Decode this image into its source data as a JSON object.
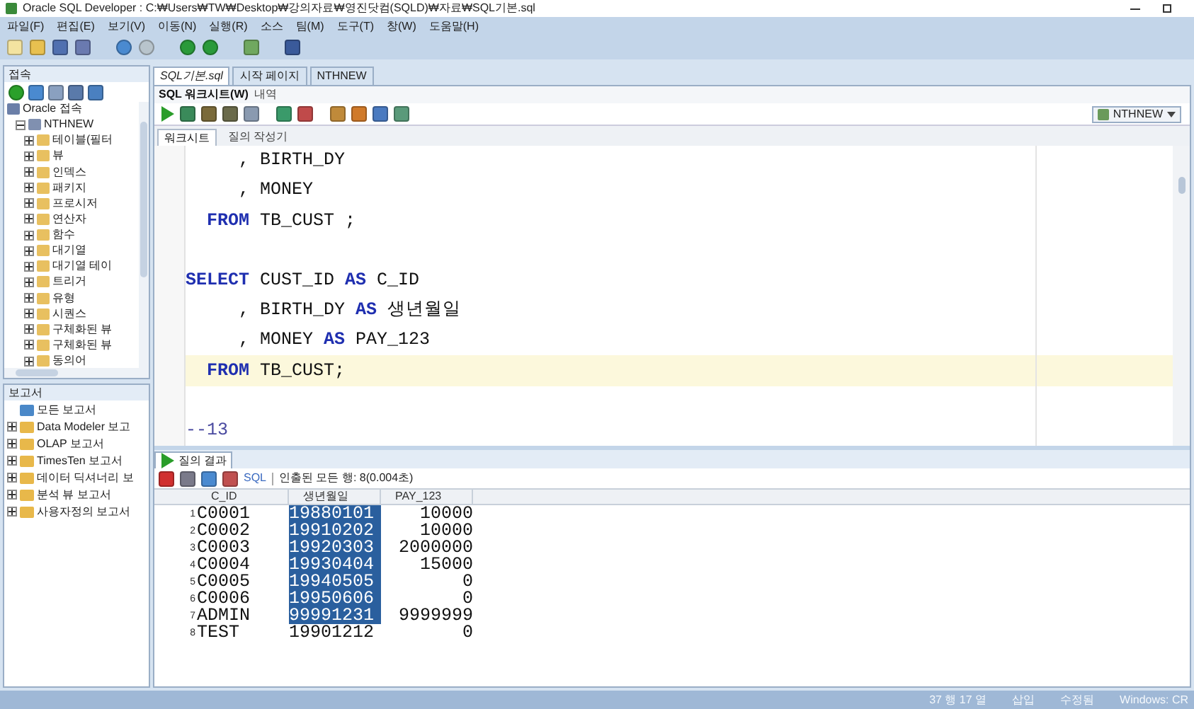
{
  "window": {
    "title": "Oracle SQL Developer : C:₩Users₩TW₩Desktop₩강의자료₩영진닷컴(SQLD)₩자료₩SQL기본.sql"
  },
  "menu": [
    "파일(F)",
    "편집(E)",
    "보기(V)",
    "이동(N)",
    "실행(R)",
    "소스",
    "팀(M)",
    "도구(T)",
    "창(W)",
    "도움말(H)"
  ],
  "connections_panel": {
    "title": "접속",
    "tree": [
      {
        "label": "Oracle 접속",
        "kind": "root",
        "children": [
          {
            "label": "NTHNEW",
            "kind": "connection",
            "expanded": true,
            "children": [
              {
                "label": "테이블(필터",
                "expanded": false
              },
              {
                "label": "뷰",
                "expanded": false
              },
              {
                "label": "인덱스",
                "expanded": false
              },
              {
                "label": "패키지",
                "expanded": false
              },
              {
                "label": "프로시저",
                "expanded": false
              },
              {
                "label": "연산자",
                "expanded": false
              },
              {
                "label": "함수",
                "expanded": false
              },
              {
                "label": "대기열",
                "expanded": false
              },
              {
                "label": "대기열 테이",
                "expanded": false
              },
              {
                "label": "트리거",
                "expanded": false
              },
              {
                "label": "유형",
                "expanded": false
              },
              {
                "label": "시퀀스",
                "expanded": false
              },
              {
                "label": "구체화된 뷰",
                "expanded": false
              },
              {
                "label": "구체화된 뷰",
                "expanded": false
              },
              {
                "label": "동의어",
                "expanded": false
              }
            ]
          }
        ]
      }
    ]
  },
  "reports_panel": {
    "title": "보고서",
    "items": [
      {
        "label": "모든 보고서",
        "kind": "root"
      },
      {
        "label": "Data Modeler 보고",
        "kind": "folder",
        "expanded": false
      },
      {
        "label": "OLAP 보고서",
        "kind": "folder",
        "expanded": false
      },
      {
        "label": "TimesTen 보고서",
        "kind": "folder",
        "expanded": false
      },
      {
        "label": "데이터 딕셔너리 보",
        "kind": "folder",
        "expanded": false
      },
      {
        "label": "분석 뷰 보고서",
        "kind": "folder",
        "expanded": false
      },
      {
        "label": "사용자정의 보고서",
        "kind": "folder",
        "expanded": false
      }
    ]
  },
  "editor_tabs": [
    {
      "label": "SQL기본.sql",
      "selected": true
    },
    {
      "label": "시작 페이지",
      "selected": false
    },
    {
      "label": "NTHNEW",
      "selected": false
    }
  ],
  "sub_tabs": [
    {
      "label": "SQL 워크시트(W)",
      "selected": true
    },
    {
      "label": "내역",
      "selected": false
    }
  ],
  "connection_selector": "NTHNEW",
  "worksheet_tabs": [
    {
      "label": "워크시트",
      "selected": true
    },
    {
      "label": "질의 작성기",
      "selected": false
    }
  ],
  "code_lines": [
    {
      "current": false,
      "tokens": [
        {
          "text": "     , BIRTH_DY",
          "kind": "plain"
        }
      ]
    },
    {
      "current": false,
      "tokens": [
        {
          "text": "     , MONEY",
          "kind": "plain"
        }
      ]
    },
    {
      "current": false,
      "tokens": [
        {
          "text": "  FROM",
          "kind": "keyword"
        },
        {
          "text": " TB_CUST ;",
          "kind": "plain"
        }
      ]
    },
    {
      "current": false
    },
    {
      "current": false,
      "tokens": [
        {
          "text": "SELECT",
          "kind": "keyword"
        },
        {
          "text": " CUST_ID ",
          "kind": "plain"
        },
        {
          "text": "AS",
          "kind": "keyword"
        },
        {
          "text": " C_ID",
          "kind": "plain"
        }
      ]
    },
    {
      "current": false,
      "tokens": [
        {
          "text": "     , BIRTH_DY ",
          "kind": "plain"
        },
        {
          "text": "AS",
          "kind": "keyword"
        },
        {
          "text": " 생년월일",
          "kind": "plain"
        }
      ]
    },
    {
      "current": false,
      "tokens": [
        {
          "text": "     , MONEY ",
          "kind": "plain"
        },
        {
          "text": "AS",
          "kind": "keyword"
        },
        {
          "text": " PAY_123",
          "kind": "plain"
        }
      ]
    },
    {
      "current": true,
      "tokens": [
        {
          "text": "  FROM",
          "kind": "keyword"
        },
        {
          "text": " TB_CUST;",
          "kind": "plain"
        }
      ]
    },
    {
      "current": false
    },
    {
      "current": false,
      "tokens": [
        {
          "text": "--13",
          "kind": "comment"
        }
      ]
    }
  ],
  "results": {
    "tab": "질의 결과",
    "sql_label": "SQL",
    "message": "인출된 모든 행: 8(0.004초)",
    "columns": [
      "C_ID",
      "생년월일",
      "PAY_123"
    ],
    "rows": [
      {
        "num": "1",
        "cells": [
          "C0001",
          "19880101",
          "10000"
        ],
        "selected": [
          false,
          true,
          false
        ]
      },
      {
        "num": "2",
        "cells": [
          "C0002",
          "19910202",
          "10000"
        ],
        "selected": [
          false,
          true,
          false
        ]
      },
      {
        "num": "3",
        "cells": [
          "C0003",
          "19920303",
          "2000000"
        ],
        "selected": [
          false,
          true,
          false
        ]
      },
      {
        "num": "4",
        "cells": [
          "C0004",
          "19930404",
          "15000"
        ],
        "selected": [
          false,
          true,
          false
        ]
      },
      {
        "num": "5",
        "cells": [
          "C0005",
          "19940505",
          "0"
        ],
        "selected": [
          false,
          true,
          false
        ]
      },
      {
        "num": "6",
        "cells": [
          "C0006",
          "19950606",
          "0"
        ],
        "selected": [
          false,
          true,
          false
        ]
      },
      {
        "num": "7",
        "cells": [
          "ADMIN",
          "99991231",
          "9999999"
        ],
        "selected": [
          false,
          true,
          false
        ]
      },
      {
        "num": "8",
        "cells": [
          "TEST",
          "19901212",
          "0"
        ],
        "selected": [
          false,
          false,
          false
        ]
      }
    ]
  },
  "status_bar": [
    "37 행 17 열",
    "삽입",
    "수정됨",
    "Windows: CR"
  ]
}
